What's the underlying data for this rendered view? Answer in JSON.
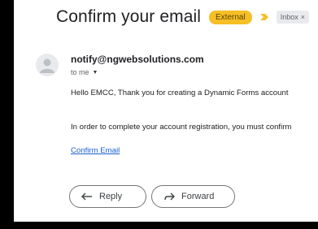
{
  "email": {
    "subject": "Confirm your email",
    "labels": {
      "external": "External",
      "inbox": "Inbox",
      "inbox_remove": "×"
    },
    "sender": "notify@ngwebsolutions.com",
    "recipient": "to me",
    "body": {
      "line1": "Hello EMCC, Thank you for creating a Dynamic Forms account",
      "line2": "In order to complete your account registration, you must confirm",
      "link": "Confirm Email"
    },
    "actions": {
      "reply": "Reply",
      "forward": "Forward"
    }
  },
  "colors": {
    "external_label": "#f6bf26",
    "importance_marker": "#f6bf26",
    "link": "#1a5fd0"
  },
  "icons": [
    "importance-marker-icon",
    "avatar-icon",
    "dropdown-caret-icon",
    "reply-icon",
    "forward-icon"
  ]
}
